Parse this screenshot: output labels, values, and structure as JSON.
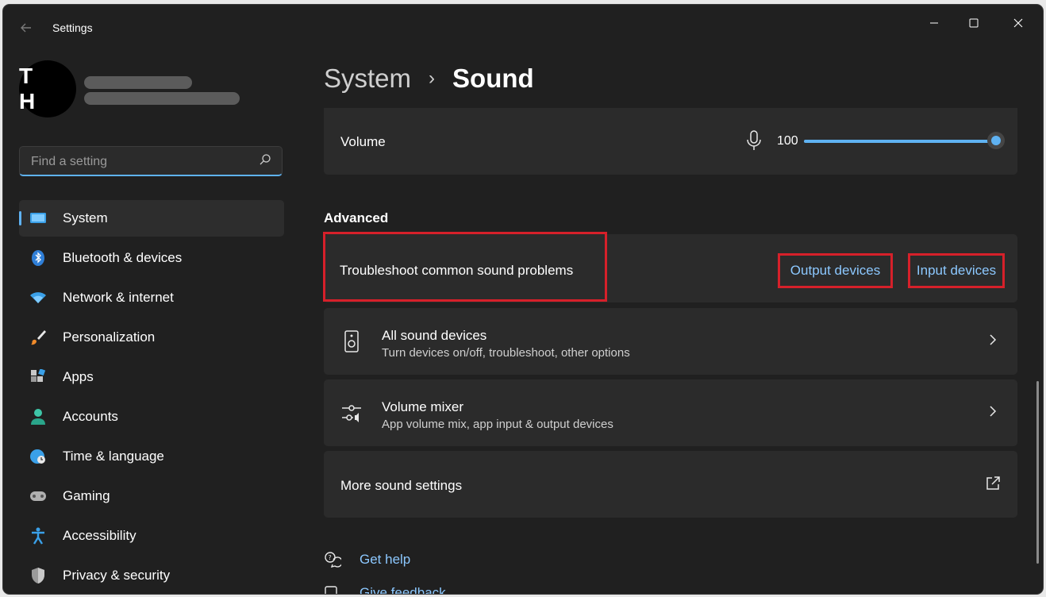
{
  "window": {
    "title": "Settings"
  },
  "profile": {
    "initials": "T H"
  },
  "search": {
    "placeholder": "Find a setting"
  },
  "sidebar": {
    "items": [
      {
        "label": "System",
        "active": true
      },
      {
        "label": "Bluetooth & devices"
      },
      {
        "label": "Network & internet"
      },
      {
        "label": "Personalization"
      },
      {
        "label": "Apps"
      },
      {
        "label": "Accounts"
      },
      {
        "label": "Time & language"
      },
      {
        "label": "Gaming"
      },
      {
        "label": "Accessibility"
      },
      {
        "label": "Privacy & security"
      }
    ]
  },
  "breadcrumb": {
    "parent": "System",
    "separator": "›",
    "current": "Sound"
  },
  "volume": {
    "label": "Volume",
    "value": "100",
    "level_percent": 100
  },
  "advanced": {
    "heading": "Advanced",
    "troubleshoot": {
      "label": "Troubleshoot common sound problems",
      "output_link": "Output devices",
      "input_link": "Input devices"
    },
    "all_devices": {
      "title": "All sound devices",
      "subtitle": "Turn devices on/off, troubleshoot, other options"
    },
    "mixer": {
      "title": "Volume mixer",
      "subtitle": "App volume mix, app input & output devices"
    },
    "more": {
      "label": "More sound settings"
    }
  },
  "footer": {
    "help": "Get help",
    "feedback": "Give feedback"
  },
  "colors": {
    "accent": "#5fb2f2",
    "link": "#8cc8ff",
    "highlight": "#d6202a",
    "card": "#2b2b2b",
    "background": "#202020"
  }
}
